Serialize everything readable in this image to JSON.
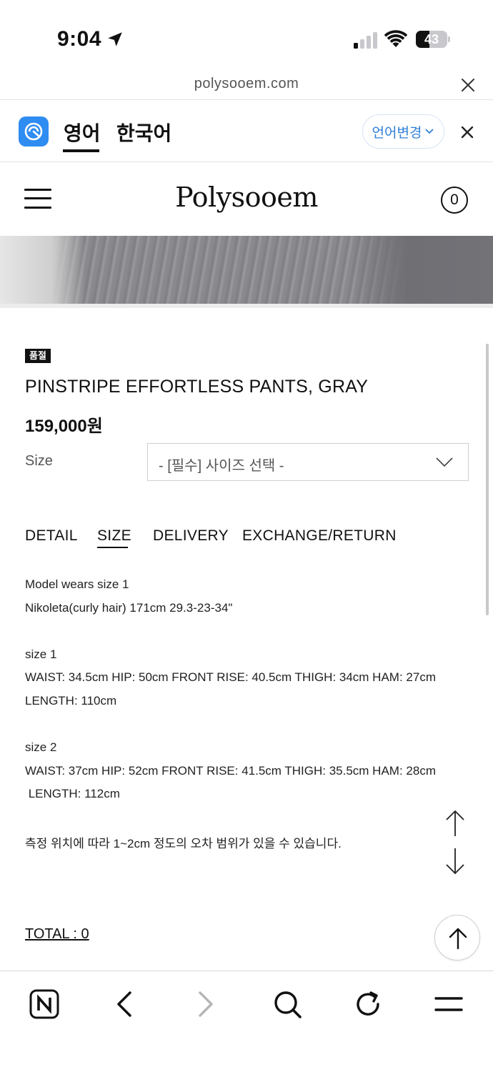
{
  "status_bar": {
    "time": "9:04",
    "battery_level": "43",
    "battery_fraction": 0.43
  },
  "url_bar": {
    "url": "polysooem.com"
  },
  "translate_bar": {
    "lang_english": "영어",
    "lang_korean": "한국어",
    "change_language": "언어변경"
  },
  "header": {
    "brand": "Polysooem",
    "cart_count": "0"
  },
  "product": {
    "badge": "품절",
    "name": "PINSTRIPE EFFORTLESS PANTS, GRAY",
    "price": "159,000원",
    "size_label": "Size",
    "size_select_placeholder": "- [필수] 사이즈 선택 -"
  },
  "tabs": [
    {
      "label": "DETAIL"
    },
    {
      "label": "SIZE"
    },
    {
      "label": "DELIVERY"
    },
    {
      "label": "EXCHANGE/RETURN"
    }
  ],
  "active_tab": "SIZE",
  "size_info": {
    "model_line": "Model wears size 1",
    "model_detail": "Nikoleta(curly hair) 171cm 29.3-23-34\"",
    "size1_title": "size 1",
    "size1_line1": "WAIST: 34.5cm HIP: 50cm FRONT RISE: 40.5cm THIGH: 34cm HAM: 27cm",
    "size1_line2": "LENGTH: 110cm",
    "size2_title": "size 2",
    "size2_line1": "WAIST: 37cm HIP: 52cm FRONT RISE: 41.5cm THIGH: 35.5cm HAM: 28cm",
    "size2_line2": " LENGTH: 112cm",
    "note": "측정 위치에 따라 1~2cm 정도의 오차 범위가 있을 수 있습니다."
  },
  "total": "TOTAL : 0",
  "bottom_toolbar": [
    "naver-icon",
    "back-icon",
    "forward-icon",
    "search-icon",
    "refresh-icon",
    "menu-icon"
  ]
}
